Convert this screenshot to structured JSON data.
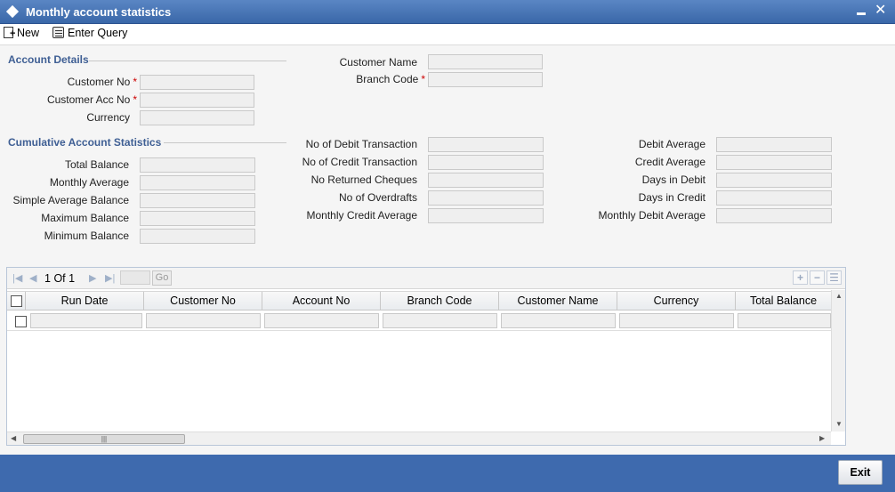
{
  "window": {
    "title": "Monthly account statistics"
  },
  "toolbar": {
    "new_label": "New",
    "enter_query_label": "Enter Query"
  },
  "account_details": {
    "title": "Account Details",
    "customer_no_label": "Customer No",
    "customer_acc_no_label": "Customer Acc No",
    "currency_label": "Currency",
    "customer_name_label": "Customer Name",
    "branch_code_label": "Branch Code",
    "required_marker": "*"
  },
  "cumulative": {
    "title": "Cumulative Account Statistics",
    "col1": [
      "Total Balance",
      "Monthly Average",
      "Simple Average Balance",
      "Maximum Balance",
      "Minimum Balance"
    ],
    "col2": [
      "No of Debit Transaction",
      "No of Credit Transaction",
      "No Returned Cheques",
      "No of Overdrafts",
      "Monthly Credit Average"
    ],
    "col3": [
      "Debit Average",
      "Credit Average",
      "Days in Debit",
      "Days in Credit",
      "Monthly Debit Average"
    ]
  },
  "grid": {
    "page_current": "1",
    "page_of": "Of",
    "page_total": "1",
    "go_label": "Go",
    "columns": [
      "Run Date",
      "Customer No",
      "Account No",
      "Branch Code",
      "Customer Name",
      "Currency",
      "Total Balance"
    ]
  },
  "footer": {
    "exit_label": "Exit"
  },
  "colors": {
    "title_bar": "#3a67a8",
    "footer": "#3e6aae",
    "section_title": "#3f5f94",
    "required": "#cc0000"
  }
}
